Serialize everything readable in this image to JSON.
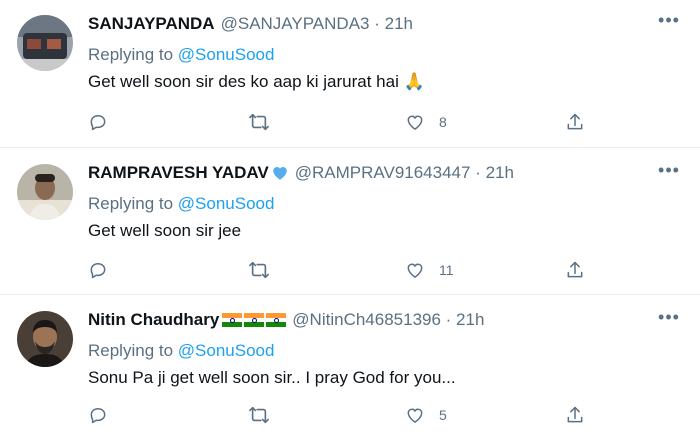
{
  "tweets": [
    {
      "name": "SANJAYPANDA",
      "handle": "@SANJAYPANDA3",
      "time": "21h",
      "replying_prefix": "Replying to",
      "replying_to": "@SonuSood",
      "text": "Get well soon sir des ko aap ki jarurat hai 🙏",
      "reply_count": "",
      "retweet_count": "",
      "like_count": "8",
      "avatar_colors": [
        "#3a3f4a",
        "#8b4a3a",
        "#c9c9c9"
      ]
    },
    {
      "name": "RAMPRAVESH YADAV",
      "handle": "@RAMPRAV91643447",
      "time": "21h",
      "replying_prefix": "Replying to",
      "replying_to": "@SonuSood",
      "text": "Get well soon sir jee",
      "reply_count": "",
      "retweet_count": "",
      "like_count": "11",
      "avatar_colors": [
        "#b9b4a8",
        "#4a4038",
        "#e8e2d6"
      ]
    },
    {
      "name": "Nitin Chaudhary",
      "handle": "@NitinCh46851396",
      "time": "21h",
      "replying_prefix": "Replying to",
      "replying_to": "@SonuSood",
      "text": "Sonu Pa ji get well soon sir.. I pray God for you...",
      "reply_count": "",
      "retweet_count": "",
      "like_count": "5",
      "avatar_colors": [
        "#2b2622",
        "#1a1716",
        "#4a3f36"
      ]
    }
  ],
  "colors": {
    "accent": "#1da1f2",
    "secondary_text": "#5b7083",
    "verified_heart": "#55acee",
    "divider": "#e6ecf0"
  },
  "icons": {
    "reply": "reply-icon",
    "retweet": "retweet-icon",
    "like": "like-icon",
    "share": "share-icon",
    "more": "more-icon",
    "verified": "blue-heart-icon",
    "flag": "india-flag-icon"
  }
}
